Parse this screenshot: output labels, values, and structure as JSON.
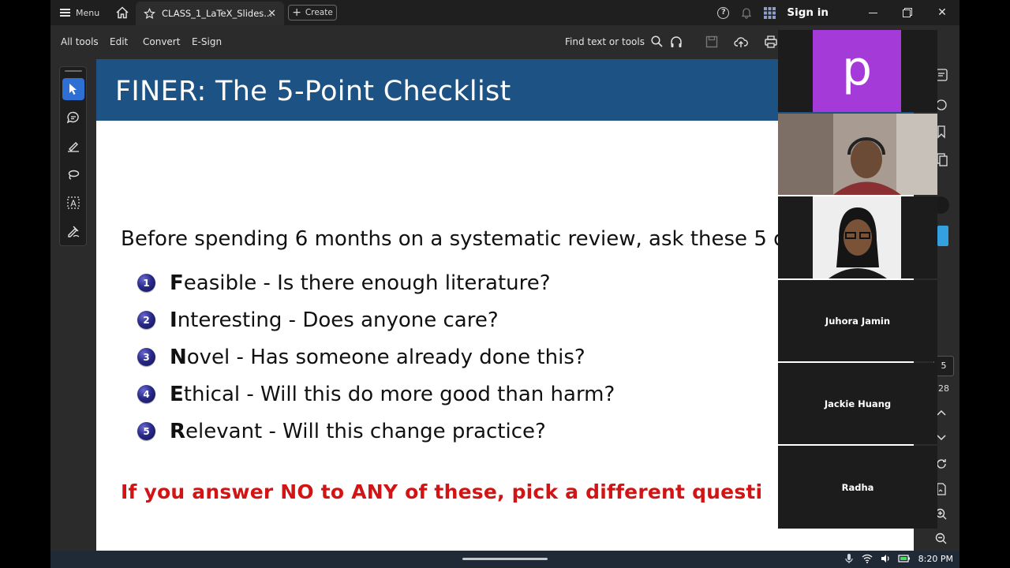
{
  "titlebar": {
    "menu_label": "Menu",
    "tab_title": "CLASS_1_LaTeX_Slides...",
    "create_label": "Create",
    "sign_in": "Sign in"
  },
  "toolbar": {
    "items": [
      "All tools",
      "Edit",
      "Convert",
      "E-Sign"
    ],
    "find_label": "Find text or tools"
  },
  "slide": {
    "title": "FINER: The 5-Point Checklist",
    "intro": "Before spending 6 months on a systematic review, ask these 5 q",
    "items": [
      {
        "num": "1",
        "letter": "F",
        "rest": "easible - Is there enough literature?"
      },
      {
        "num": "2",
        "letter": "I",
        "rest": "nteresting - Does anyone care?"
      },
      {
        "num": "3",
        "letter": "N",
        "rest": "ovel - Has someone already done this?"
      },
      {
        "num": "4",
        "letter": "E",
        "rest": "thical - Will this do more good than harm?"
      },
      {
        "num": "5",
        "letter": "R",
        "rest": "elevant - Will this change practice?"
      }
    ],
    "warning": "If you answer NO to ANY of these, pick a different questi"
  },
  "page_nav": {
    "current": "5",
    "total": "28"
  },
  "video": {
    "avatar_letter": "p",
    "participants": [
      "Juhora Jamin",
      "Jackie Huang",
      "Radha"
    ]
  },
  "taskbar": {
    "clock": "8:20 PM"
  },
  "colors": {
    "slide_header": "#1c5384",
    "warning_red": "#d21414",
    "avatar_purple": "#a43ad8",
    "active_tool": "#2e6fd3"
  }
}
